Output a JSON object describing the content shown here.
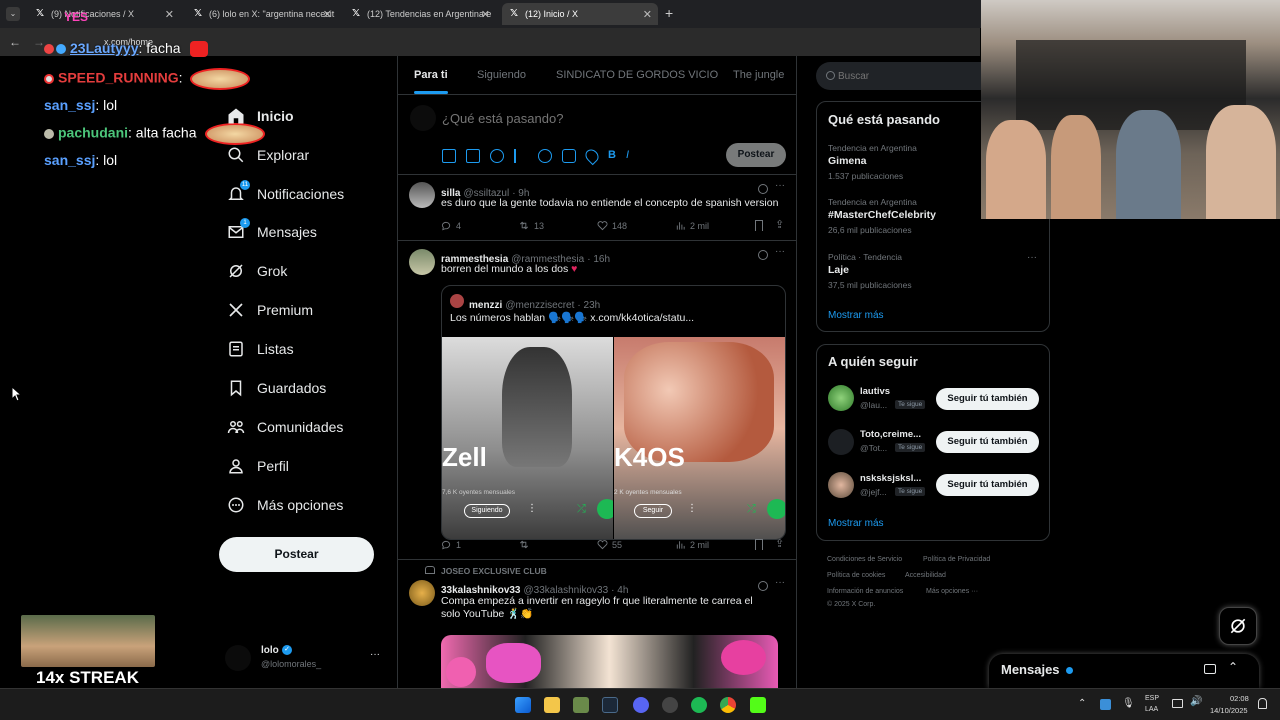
{
  "browser": {
    "tabs": [
      {
        "title": "(9) Notificaciones / X"
      },
      {
        "title": "(6) lolo en X: \"argentina necesit"
      },
      {
        "title": "(12) Tendencias en Argentina e"
      },
      {
        "title": "(12) Inicio / X"
      }
    ],
    "url": "x.com/home"
  },
  "chat": [
    {
      "user": "23Lautyyy",
      "msg": ": facha"
    },
    {
      "user": "SPEED_RUNNING",
      "msg": ":"
    },
    {
      "user": "san_ssj",
      "msg": ": lol"
    },
    {
      "user": "pachudani",
      "msg": ": alta facha"
    },
    {
      "user": "san_ssj",
      "msg": ": lol"
    }
  ],
  "overlay": {
    "yes_text": "YES",
    "streak": "14x STREAK"
  },
  "nav": {
    "inicio": "Inicio",
    "explorar": "Explorar",
    "notificaciones": "Notificaciones",
    "notif_badge": "11",
    "mensajes": "Mensajes",
    "msg_badge": "1",
    "grok": "Grok",
    "premium": "Premium",
    "listas": "Listas",
    "guardados": "Guardados",
    "comunidades": "Comunidades",
    "perfil": "Perfil",
    "mas": "Más opciones",
    "postear": "Postear"
  },
  "account": {
    "name": "lolo",
    "handle": "@lolomorales_",
    "more": "···"
  },
  "feed_tabs": [
    "Para ti",
    "Siguiendo",
    "SINDICATO DE GORDOS VICIO",
    "The jungle"
  ],
  "composer": {
    "placeholder": "¿Qué está pasando?",
    "button": "Postear"
  },
  "tweets": [
    {
      "name": "silla",
      "handle": "@ssiltazul",
      "time": "· 9h",
      "text": "es duro que la gente todavia no entiende el concepto de spanish version",
      "replies": "4",
      "reposts": "13",
      "likes": "148",
      "views": "2 mil"
    },
    {
      "name": "rammesthesia",
      "handle": "@rammesthesia",
      "time": "· 16h",
      "text": "borren del mundo a los dos",
      "quote": {
        "name": "menzzi",
        "handle": "@menzzisecret",
        "time": "· 23h",
        "text": "Los números hablan 🗣️🗣️🗣️ x.com/kk4otica/statu...",
        "card1": {
          "artist": "Zell",
          "listeners": "7,6 K oyentes mensuales",
          "button": "Siguiendo"
        },
        "card2": {
          "artist": "K4OS",
          "listeners": "2 K oyentes mensuales",
          "button": "Seguir"
        }
      },
      "replies": "1",
      "reposts": "",
      "likes": "55",
      "views": "2 mil"
    },
    {
      "community": "JOSEO EXCLUSIVE CLUB",
      "name": "33kalashnikov33",
      "handle": "@33kalashnikov33",
      "time": "· 4h",
      "text": "Compa empezá a invertir en rageylo fr que literalmente te carrea el solo YouTube 🕺👏"
    }
  ],
  "search": {
    "placeholder": "Buscar"
  },
  "trends": {
    "title": "Qué está pasando",
    "items": [
      {
        "meta": "Tendencia en Argentina",
        "title": "Gimena",
        "count": "1.537 publicaciones"
      },
      {
        "meta": "Tendencia en Argentina",
        "title": "#MasterChefCelebrity",
        "count": "26,6 mil publicaciones"
      },
      {
        "meta": "Política · Tendencia",
        "title": "Laje",
        "count": "37,5 mil publicaciones"
      }
    ],
    "more": "Mostrar más"
  },
  "who_to_follow": {
    "title": "A quién seguir",
    "items": [
      {
        "name": "lautivs",
        "handle": "@lau...",
        "badge": "Te sigue",
        "button": "Seguir tú también"
      },
      {
        "name": "Toto,creime...",
        "handle": "@Tot...",
        "badge": "Te sigue",
        "button": "Seguir tú también"
      },
      {
        "name": "nsksksjsksl...",
        "handle": "@jejf...",
        "badge": "Te sigue",
        "button": "Seguir tú también"
      }
    ],
    "more": "Mostrar más"
  },
  "footer": {
    "terms": "Condiciones de Servicio",
    "privacy": "Política de Privacidad",
    "cookies": "Política de cookies",
    "access": "Accesibilidad",
    "ads": "Información de anuncios",
    "more": "Más opciones ···",
    "copy": "© 2025 X Corp."
  },
  "messages_drawer": {
    "title": "Mensajes"
  },
  "taskbar": {
    "lang1": "ESP",
    "lang2": "LAA",
    "time": "02:08",
    "date": "14/10/2025"
  },
  "colors": {
    "accent": "#1d9bf0",
    "bg": "#000000",
    "border": "#2f3336",
    "muted": "#71767b"
  }
}
